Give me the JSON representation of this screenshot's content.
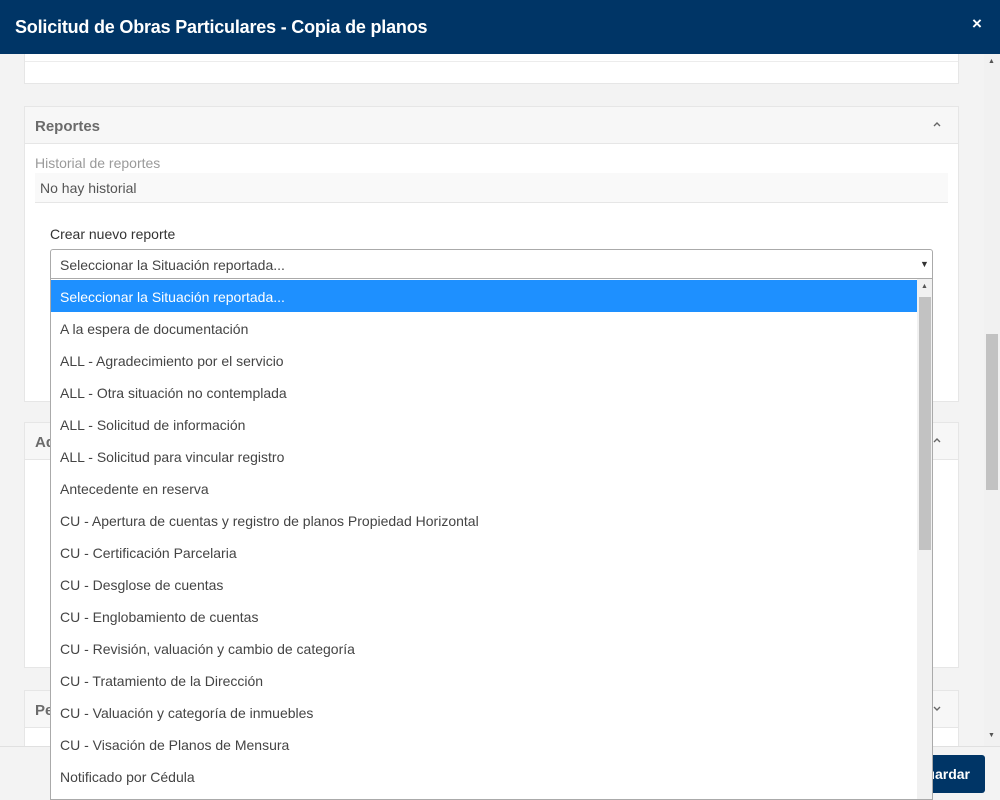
{
  "modal": {
    "title": "Solicitud de Obras Particulares - Copia de planos",
    "close_icon": "×"
  },
  "reportes": {
    "title": "Reportes",
    "historial_label": "Historial de reportes",
    "historial_empty": "No hay historial",
    "crear_label": "Crear nuevo reporte"
  },
  "panels": {
    "ad_title": "Ad",
    "pe_title": "Pe"
  },
  "select": {
    "selected_value": "Seleccionar la Situación reportada...",
    "options": [
      "Seleccionar la Situación reportada...",
      "A la espera de documentación",
      "ALL - Agradecimiento por el servicio",
      "ALL - Otra situación no contemplada",
      "ALL - Solicitud de información",
      "ALL - Solicitud para vincular registro",
      "Antecedente en reserva",
      "CU - Apertura de cuentas y registro de planos Propiedad Horizontal",
      "CU - Certificación Parcelaria",
      "CU - Desglose de cuentas",
      "CU - Englobamiento de cuentas",
      "CU - Revisión, valuación y cambio de categoría",
      "CU - Tratamiento de la Dirección",
      "CU - Valuación y categoría de inmuebles",
      "CU - Visación de Planos de Mensura",
      "Notificado por Cédula"
    ]
  },
  "footer": {
    "save_label": "uardar"
  },
  "colors": {
    "header": "#003566",
    "selected_option": "#1e90ff"
  }
}
